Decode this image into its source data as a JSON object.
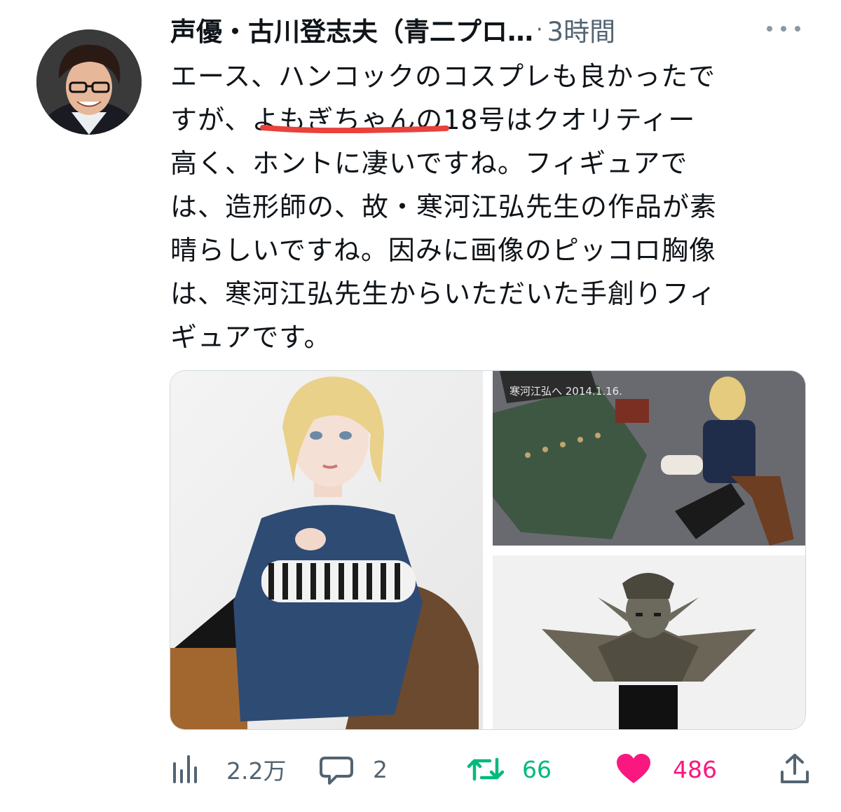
{
  "tweet": {
    "author_name": "声優・古川登志夫（青二プロ…",
    "separator": "·",
    "time": "3時間",
    "text_lines": [
      "エース、ハンコックのコスプレも良かったで",
      "すが、よもぎちゃんの18号はクオリティー",
      "高く、ホントに凄いですね。フィギュアで",
      "は、造形師の、故・寒河江弘先生の作品が素",
      "晴らしいですね。因みに画像のピッコロ胸像",
      "は、寒河江弘先生からいただいた手創りフィ",
      "ギュアです。"
    ],
    "underline_color": "#e8423b",
    "figure_signature_text": "寒河江弘へ 2014.1.16."
  },
  "actions": {
    "views": "2.2万",
    "replies": "2",
    "retweets": "66",
    "likes": "486"
  },
  "colors": {
    "text": "#0f1419",
    "secondary": "#536471",
    "retweet_active": "#00ba7c",
    "like_active": "#f91880",
    "border": "#cfd9de"
  },
  "icons": {
    "views": "bar-chart-icon",
    "reply": "speech-bubble-icon",
    "retweet": "retweet-icon",
    "like": "heart-icon",
    "share": "share-icon",
    "more": "more-dots-icon"
  }
}
